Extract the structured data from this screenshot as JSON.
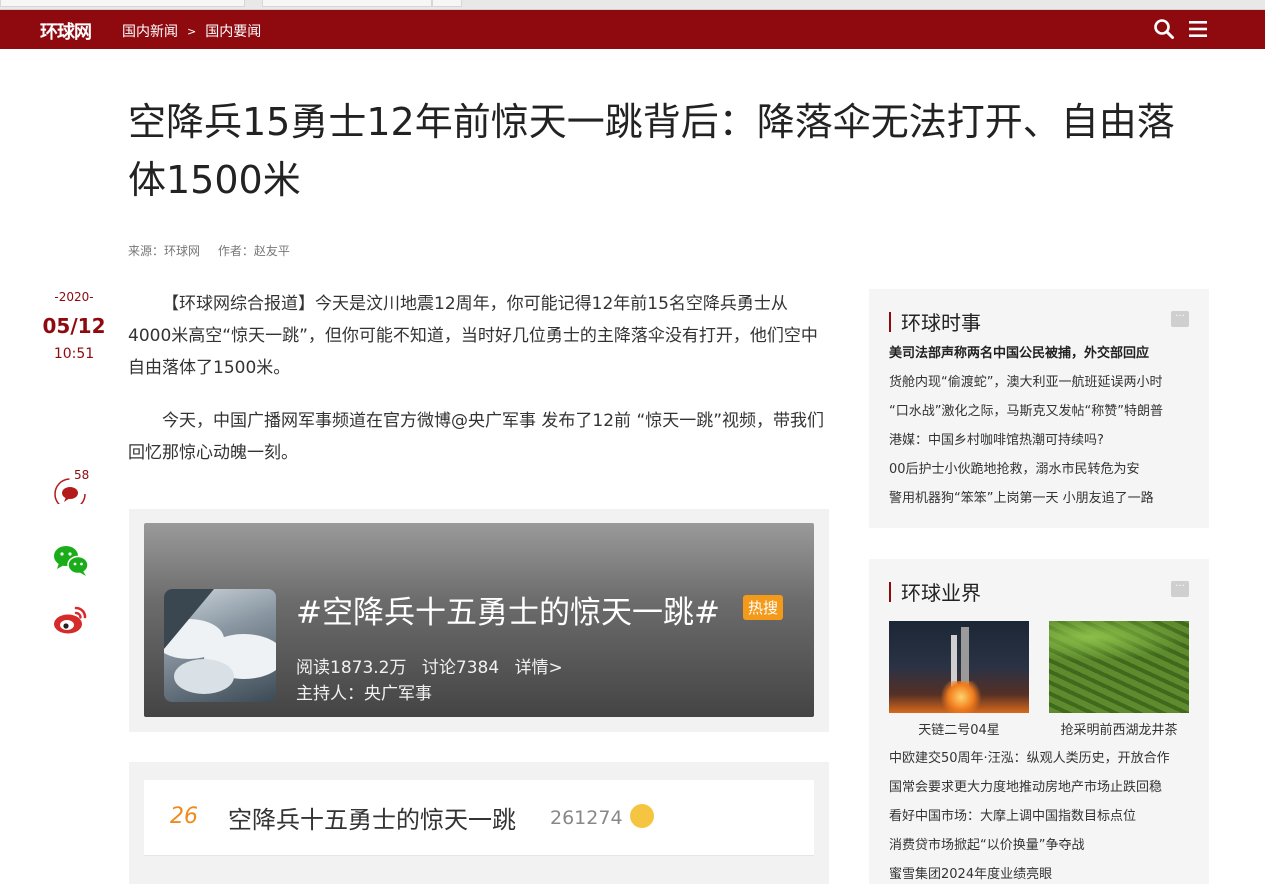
{
  "header": {
    "logo": "环球网",
    "breadcrumb": [
      "国内新闻",
      "国内要闻"
    ],
    "breadcrumb_sep": ">"
  },
  "article": {
    "title": "空降兵15勇士12年前惊天一跳背后：降落伞无法打开、自由落体1500米",
    "source": "来源：环球网",
    "author": "作者：赵友平",
    "date_year": "-2020-",
    "date_md": "05/12",
    "date_time": "10:51",
    "comment_count": "58",
    "paragraphs": [
      "【环球网综合报道】今天是汶川地震12周年，你可能记得12年前15名空降兵勇士从4000米高空“惊天一跳”，但你可能不知道，当时好几位勇士的主降落伞没有打开，他们空中自由落体了1500米。",
      "今天，中国广播网军事频道在官方微博@央广军事 发布了12前 “惊天一跳”视频，带我们回忆那惊心动魄一刻。"
    ]
  },
  "embed": {
    "hashtag": "#空降兵十五勇士的惊天一跳#",
    "hot_badge": "热搜",
    "read": "阅读1873.2万",
    "discuss": "讨论7384",
    "detail": "详情>",
    "host": "主持人：央广军事"
  },
  "hotlist": {
    "rank": "26",
    "text": "空降兵十五勇士的惊天一跳",
    "count": "261274"
  },
  "sidebar": {
    "box1": {
      "title": "环球时事",
      "more": "···",
      "items": [
        "美司法部声称两名中国公民被捕，外交部回应",
        "货舱内现“偷渡蛇”，澳大利亚一航班延误两小时",
        "“口水战”激化之际，马斯克又发帖“称赞”特朗普",
        "港媒：中国乡村咖啡馆热潮可持续吗?",
        "00后护士小伙跪地抢救，溺水市民转危为安",
        "警用机器狗“笨笨”上岗第一天 小朋友追了一路"
      ]
    },
    "box2": {
      "title": "环球业界",
      "more": "···",
      "pics": [
        {
          "caption": "天链二号04星"
        },
        {
          "caption": "抢采明前西湖龙井茶"
        }
      ],
      "items": [
        "中欧建交50周年·汪泓：纵观人类历史，开放合作",
        "国常会要求更大力度地推动房地产市场止跌回稳",
        "看好中国市场：大摩上调中国指数目标点位",
        "消费贷市场掀起“以价换量”争夺战",
        "蜜雪集团2024年度业绩亮眼"
      ]
    }
  }
}
